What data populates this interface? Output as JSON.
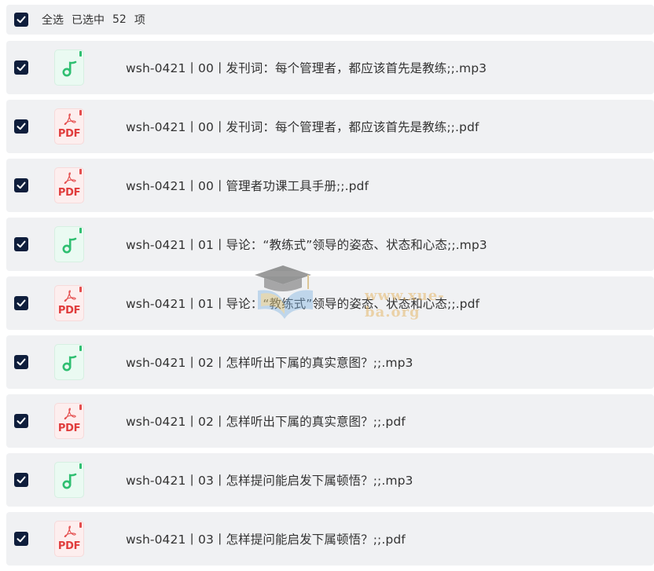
{
  "header": {
    "select_all_label": "全选",
    "selected_prefix": "已选中",
    "selected_count": "52",
    "selected_suffix": "项",
    "checked": true
  },
  "files": [
    {
      "name": "wsh-0421丨00丨发刊词：每个管理者，都应该首先是教练;;.mp3",
      "type": "mp3",
      "checked": true
    },
    {
      "name": "wsh-0421丨00丨发刊词：每个管理者，都应该首先是教练;;.pdf",
      "type": "pdf",
      "checked": true
    },
    {
      "name": "wsh-0421丨00丨管理者功课工具手册;;.pdf",
      "type": "pdf",
      "checked": true
    },
    {
      "name": "wsh-0421丨01丨导论：“教练式”领导的姿态、状态和心态;;.mp3",
      "type": "mp3",
      "checked": true
    },
    {
      "name": "wsh-0421丨01丨导论：“教练式”领导的姿态、状态和心态;;.pdf",
      "type": "pdf",
      "checked": true
    },
    {
      "name": "wsh-0421丨02丨怎样听出下属的真实意图？;;.mp3",
      "type": "mp3",
      "checked": true
    },
    {
      "name": "wsh-0421丨02丨怎样听出下属的真实意图？;;.pdf",
      "type": "pdf",
      "checked": true
    },
    {
      "name": "wsh-0421丨03丨怎样提问能启发下属顿悟？;;.mp3",
      "type": "mp3",
      "checked": true
    },
    {
      "name": "wsh-0421丨03丨怎样提问能启发下属顿悟？;;.pdf",
      "type": "pdf",
      "checked": true
    }
  ],
  "pdf_icon_label": "PDF",
  "watermark": "www.xue-ba.org",
  "colors": {
    "checkbox": "#0f1e3c",
    "row_background": "#f0f1f3",
    "mp3_accent": "#2fbf71",
    "pdf_accent": "#e03c3c"
  }
}
